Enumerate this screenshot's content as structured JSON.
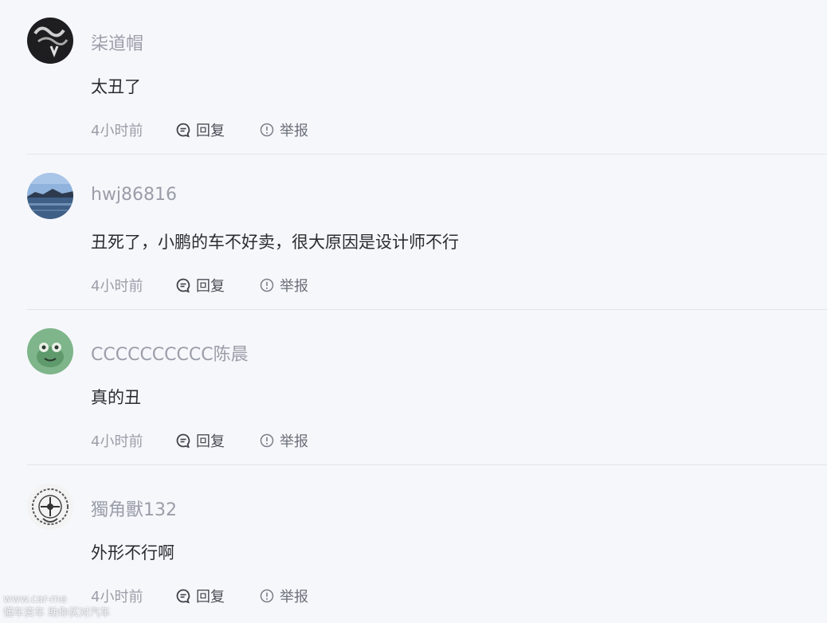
{
  "comments": [
    {
      "username": "柒道帽",
      "text": "太丑了",
      "time": "4小时前",
      "reply_label": "回复",
      "report_label": "举报",
      "avatar": "dark-graffiti-avatar"
    },
    {
      "username": "hwj86816",
      "text": "丑死了，小鹏的车不好卖，很大原因是设计师不行",
      "time": "4小时前",
      "reply_label": "回复",
      "report_label": "举报",
      "avatar": "lake-landscape-avatar"
    },
    {
      "username": "CCCCCCCCCC陈晨",
      "text": "真的丑",
      "time": "4小时前",
      "reply_label": "回复",
      "report_label": "举报",
      "avatar": "green-frog-avatar"
    },
    {
      "username": "獨角獸132",
      "text": "外形不行啊",
      "time": "4小时前",
      "reply_label": "回复",
      "report_label": "举报",
      "avatar": "ornamental-emblem-avatar"
    }
  ],
  "watermark": {
    "line1": "www.car-me",
    "line2": "懂车资车 助你买对汽车"
  },
  "icons": {
    "reply": "comment-bubble-icon",
    "report": "exclamation-circle-icon"
  },
  "colors": {
    "background": "#f6f7fb",
    "username": "#9a9ea8",
    "text": "#2a2c31",
    "divider": "#e2e4ea"
  }
}
